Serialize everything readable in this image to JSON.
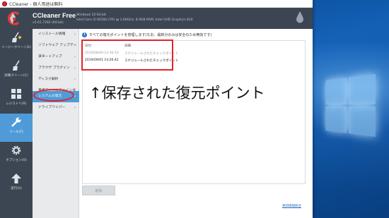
{
  "window": {
    "title": "CCleaner - 個人用途は無料"
  },
  "header": {
    "app_name": "CCleaner Free",
    "version": "v5.61.7392 (64-bit)",
    "sysinfo_line1": "Windows 10 64-bit",
    "sysinfo_line2": "Intel Core i5-9250U CPU @ 1.60GHz, 8.0GB RAM, Intel UHD Graphics 620"
  },
  "sidebar": {
    "items": [
      {
        "label": "イージークリーン(E)",
        "icon": "broom-sparkle-icon"
      },
      {
        "label": "詳細クリーン(C)",
        "icon": "broom-icon"
      },
      {
        "label": "レジストリ(R)",
        "icon": "grid-icon"
      },
      {
        "label": "ツール(T)",
        "icon": "wrench-icon",
        "active": true
      },
      {
        "label": "オプション(O)",
        "icon": "gear-icon"
      },
      {
        "label": "実行(U)",
        "icon": "arrow-up-icon"
      }
    ]
  },
  "submenu": {
    "items": [
      {
        "label": "インストール情報"
      },
      {
        "label": "ソフトウェア アップデーター"
      },
      {
        "label": "スタートアップ"
      },
      {
        "label": "ブラウザ プラグイン"
      },
      {
        "label": "ディスク解析"
      },
      {
        "label": "重複ファイルファインダ"
      },
      {
        "label": "システムの復元",
        "active": true
      },
      {
        "label": "ドライブワイパー"
      }
    ]
  },
  "main": {
    "info_text": "すべての復元ポイントを管理します(なお、最新分のみは安全のため無効です)",
    "columns": {
      "date": "日付",
      "detail": "詳細"
    },
    "rows": [
      {
        "date": "2019/08/09 12:36:10",
        "detail": "スケジュールされたチェックポイント",
        "enabled": false
      },
      {
        "date": "2019/09/01 14:26:42",
        "detail": "スケジュールされたチェックポイント",
        "enabled": true
      }
    ],
    "delete_label": "削除",
    "bottom_link": "更新情報照合"
  },
  "annotation": {
    "caption": "↑保存された復元ポイント"
  },
  "colors": {
    "sidebar_bg": "#3c4652",
    "accent": "#4f9bd8",
    "highlight_red": "#e0242b",
    "desktop_blue": "#0e5bb0"
  }
}
